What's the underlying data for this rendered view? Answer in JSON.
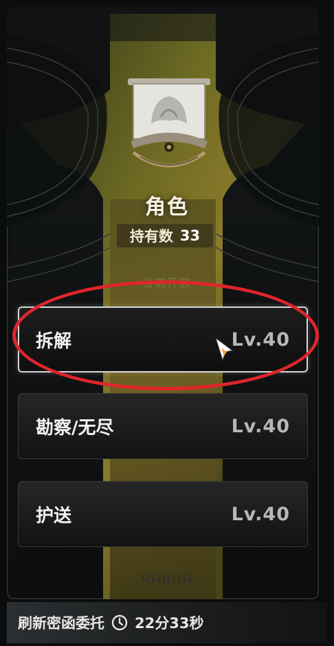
{
  "panel": {
    "title": "角色",
    "owned_label": "持有数",
    "owned_count": "33",
    "open_label": "当前开放",
    "rune_text": "ЧНІІНН"
  },
  "entries": [
    {
      "name": "拆解",
      "level": "Lv.40",
      "selected": true
    },
    {
      "name": "勘察/无尽",
      "level": "Lv.40",
      "selected": false
    },
    {
      "name": "护送",
      "level": "Lv.40",
      "selected": false
    }
  ],
  "footer": {
    "refresh_label": "刷新密函委托",
    "timer": "22分33秒",
    "icon": "clock-icon"
  },
  "colors": {
    "accent_gold": "#c9a24a",
    "highlight_red": "#e0252b",
    "cursor_orange": "#f2a33a"
  }
}
